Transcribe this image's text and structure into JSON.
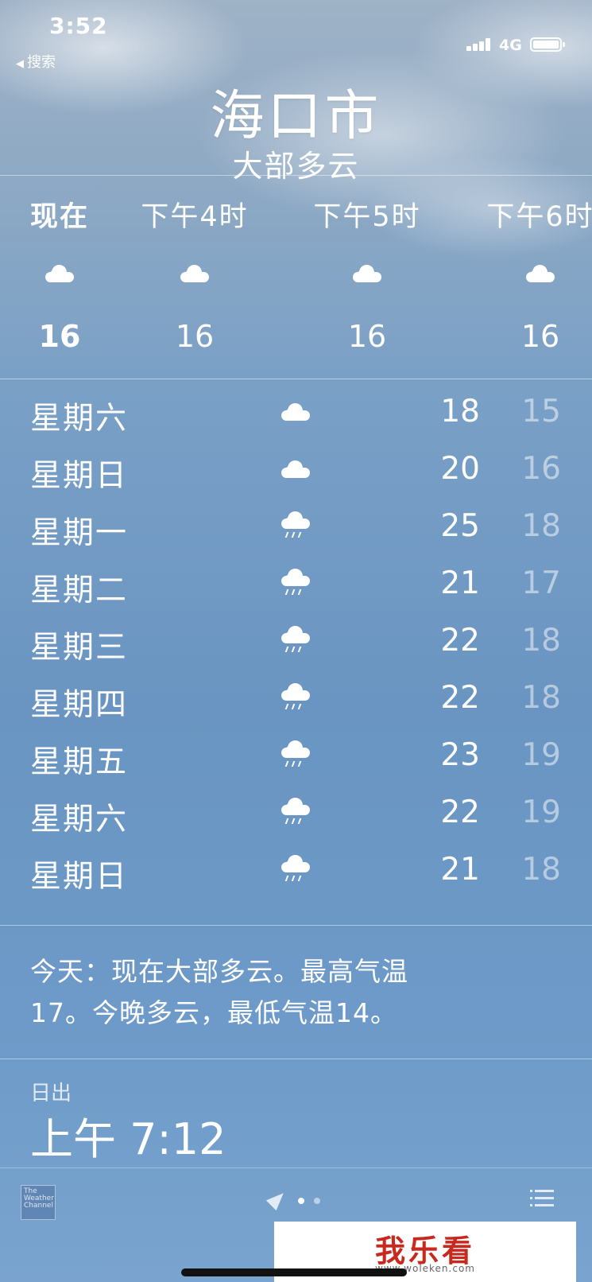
{
  "status_bar": {
    "time": "3:52",
    "back_label": "搜索",
    "network": "4G"
  },
  "header": {
    "city": "海口市",
    "condition": "大部多云"
  },
  "hourly": [
    {
      "label": "现在",
      "icon": "cloud-icon",
      "temp": "16"
    },
    {
      "label": "下午4时",
      "icon": "cloud-icon",
      "temp": "16"
    },
    {
      "label": "下午5时",
      "icon": "cloud-icon",
      "temp": "16"
    },
    {
      "label": "下午6时",
      "icon": "cloud-icon",
      "temp": "16"
    }
  ],
  "daily": [
    {
      "day": "星期六",
      "icon": "cloud-icon",
      "high": "18",
      "low": "15"
    },
    {
      "day": "星期日",
      "icon": "cloud-icon",
      "high": "20",
      "low": "16"
    },
    {
      "day": "星期一",
      "icon": "rain-cloud-icon",
      "high": "25",
      "low": "18"
    },
    {
      "day": "星期二",
      "icon": "rain-cloud-icon",
      "high": "21",
      "low": "17"
    },
    {
      "day": "星期三",
      "icon": "rain-cloud-icon",
      "high": "22",
      "low": "18"
    },
    {
      "day": "星期四",
      "icon": "rain-cloud-icon",
      "high": "22",
      "low": "18"
    },
    {
      "day": "星期五",
      "icon": "rain-cloud-icon",
      "high": "23",
      "low": "19"
    },
    {
      "day": "星期六",
      "icon": "rain-cloud-icon",
      "high": "22",
      "low": "19"
    },
    {
      "day": "星期日",
      "icon": "rain-cloud-icon",
      "high": "21",
      "low": "18"
    }
  ],
  "summary": {
    "line1": "今天：现在大部多云。最高气温",
    "line2": "17。今晚多云，最低气温14。"
  },
  "sunrise": {
    "label": "日出",
    "value": "上午 7:12"
  },
  "footer": {
    "logo_line1": "The",
    "logo_line2": "Weather",
    "logo_line3": "Channel"
  },
  "watermark": {
    "main": "我乐看",
    "url": "www.woleken.com"
  }
}
